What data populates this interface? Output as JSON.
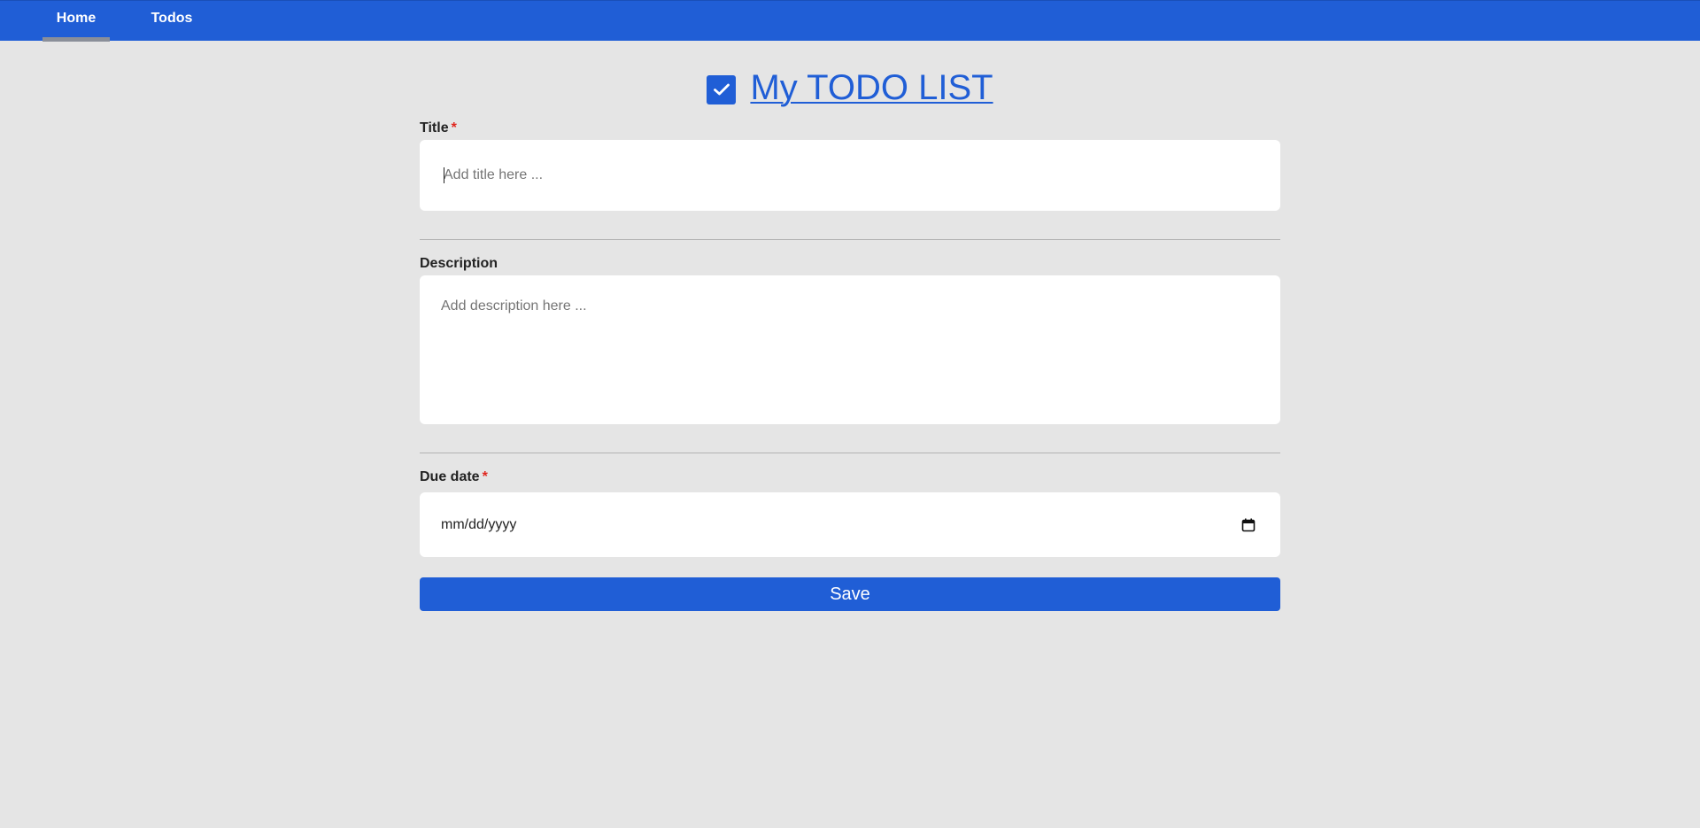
{
  "nav": {
    "items": [
      {
        "label": "Home",
        "active": true
      },
      {
        "label": "Todos",
        "active": false
      }
    ]
  },
  "header": {
    "title": "My TODO LIST",
    "icon": "checkbox-checked-icon"
  },
  "form": {
    "title_label": "Title",
    "title_required_mark": "*",
    "title_placeholder": "Add title here ...",
    "title_value": "",
    "description_label": "Description",
    "description_placeholder": "Add description here ...",
    "description_value": "",
    "due_date_label": "Due date",
    "due_date_required_mark": "*",
    "due_date_placeholder": "mm/dd/yyyy",
    "due_date_icon": "calendar-icon",
    "save_label": "Save"
  },
  "colors": {
    "primary": "#205ed6",
    "background": "#e5e5e5",
    "required": "#e0261e",
    "active_tab_indicator": "#8a8f99"
  }
}
